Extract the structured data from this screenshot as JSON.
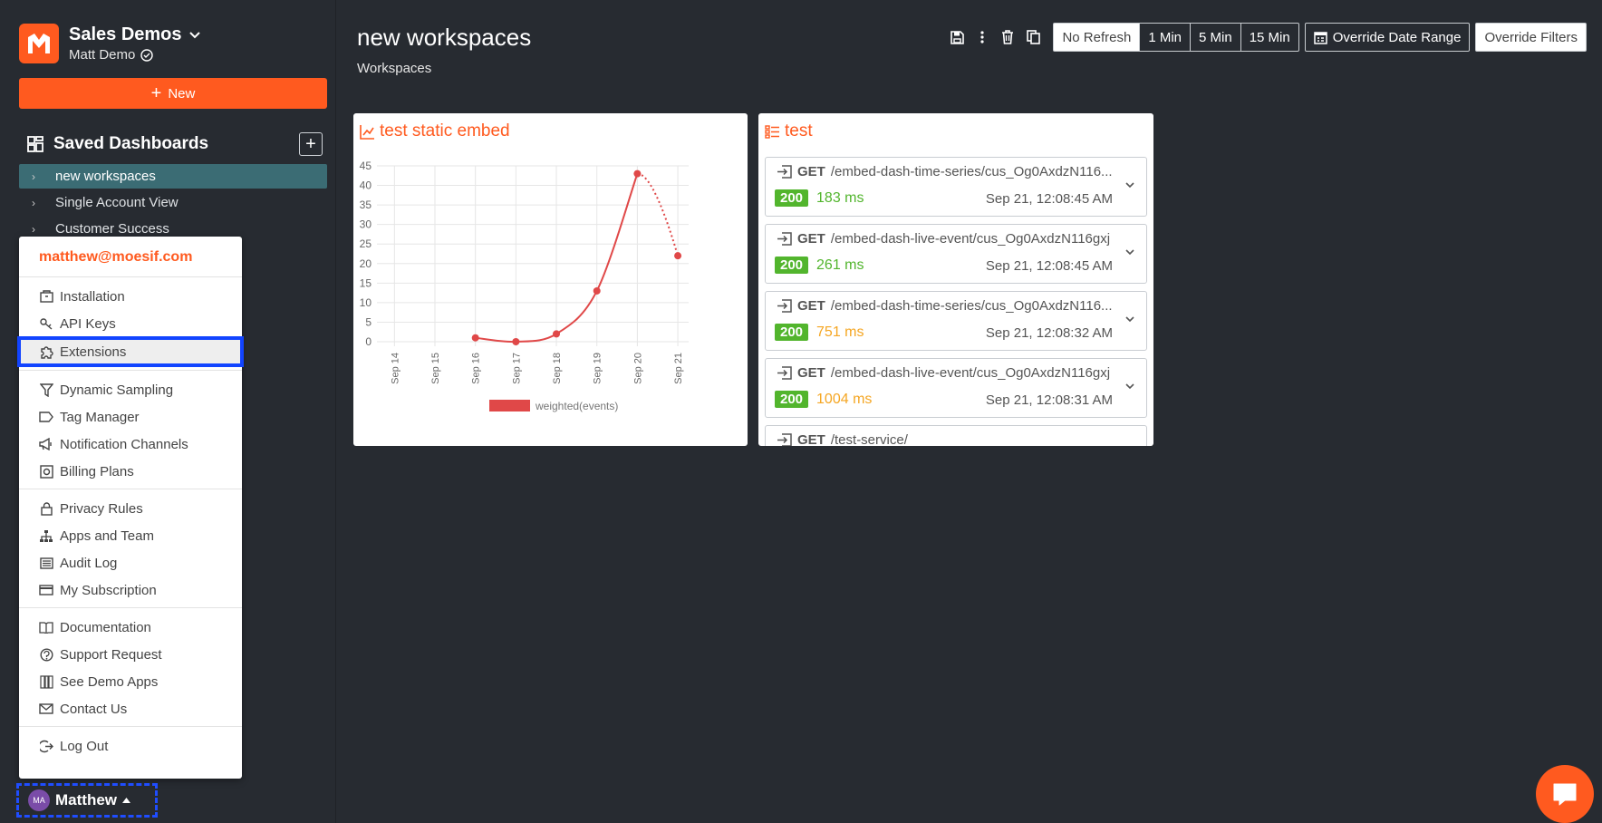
{
  "sidebar": {
    "org_name": "Sales Demos",
    "user_sub": "Matt Demo",
    "new_label": "New",
    "saved_title": "Saved Dashboards",
    "dashboards": [
      {
        "label": "new workspaces",
        "active": true
      },
      {
        "label": "Single Account View",
        "active": false
      },
      {
        "label": "Customer Success",
        "active": false
      }
    ]
  },
  "account_menu": {
    "email": "matthew@moesif.com",
    "groups": [
      [
        {
          "label": "Installation",
          "icon": "installation-icon"
        },
        {
          "label": "API Keys",
          "icon": "key-icon"
        },
        {
          "label": "Extensions",
          "icon": "puzzle-icon",
          "highlight": true
        }
      ],
      [
        {
          "label": "Dynamic Sampling",
          "icon": "filter-icon"
        },
        {
          "label": "Tag Manager",
          "icon": "tag-icon"
        },
        {
          "label": "Notification Channels",
          "icon": "megaphone-icon"
        },
        {
          "label": "Billing Plans",
          "icon": "billing-icon"
        }
      ],
      [
        {
          "label": "Privacy Rules",
          "icon": "lock-icon"
        },
        {
          "label": "Apps and Team",
          "icon": "sitemap-icon"
        },
        {
          "label": "Audit Log",
          "icon": "list-icon"
        },
        {
          "label": "My Subscription",
          "icon": "credit-card-icon"
        }
      ],
      [
        {
          "label": "Documentation",
          "icon": "book-icon"
        },
        {
          "label": "Support Request",
          "icon": "support-icon"
        },
        {
          "label": "See Demo Apps",
          "icon": "apps-icon"
        },
        {
          "label": "Contact Us",
          "icon": "mail-icon"
        }
      ],
      [
        {
          "label": "Log Out",
          "icon": "logout-icon"
        }
      ]
    ]
  },
  "user_chip": {
    "initials": "MA",
    "name": "Matthew"
  },
  "header": {
    "title": "new workspaces",
    "subtitle": "Workspaces",
    "refresh_options": [
      "No Refresh",
      "1 Min",
      "5 Min",
      "15 Min"
    ],
    "refresh_selected": "No Refresh",
    "override_date_label": "Override Date Range",
    "override_filters_label": "Override Filters"
  },
  "colors": {
    "accent": "#ff5a1f",
    "line": "#e04848",
    "success": "#52b52d",
    "slow": "#f5a623",
    "sidebar_active": "#3b6c74"
  },
  "widgets": {
    "chart_title": "test static embed",
    "events_title": "test"
  },
  "chart_data": {
    "type": "line",
    "categories": [
      "Sep 14",
      "Sep 15",
      "Sep 16",
      "Sep 17",
      "Sep 18",
      "Sep 19",
      "Sep 20",
      "Sep 21"
    ],
    "series": [
      {
        "name": "weighted(events)",
        "values": [
          null,
          null,
          1,
          0,
          2,
          13,
          43,
          22
        ]
      }
    ],
    "ylim": [
      0,
      45
    ],
    "yticks": [
      0,
      5,
      10,
      15,
      20,
      25,
      30,
      35,
      40,
      45
    ],
    "grid": true,
    "legend": "bottom",
    "last_segment_dotted": true
  },
  "events": [
    {
      "method": "GET",
      "path": "/embed-dash-time-series/cus_Og0AxdzN116...",
      "status": "200",
      "latency": "183 ms",
      "latency_color": "#52b52d",
      "time": "Sep 21, 12:08:45 AM"
    },
    {
      "method": "GET",
      "path": "/embed-dash-live-event/cus_Og0AxdzN116gxj",
      "status": "200",
      "latency": "261 ms",
      "latency_color": "#52b52d",
      "time": "Sep 21, 12:08:45 AM"
    },
    {
      "method": "GET",
      "path": "/embed-dash-time-series/cus_Og0AxdzN116...",
      "status": "200",
      "latency": "751 ms",
      "latency_color": "#f5a623",
      "time": "Sep 21, 12:08:32 AM"
    },
    {
      "method": "GET",
      "path": "/embed-dash-live-event/cus_Og0AxdzN116gxj",
      "status": "200",
      "latency": "1004 ms",
      "latency_color": "#f5a623",
      "time": "Sep 21, 12:08:31 AM"
    },
    {
      "method": "GET",
      "path": "/test-service/",
      "status": "",
      "latency": "",
      "latency_color": "#52b52d",
      "time": ""
    }
  ]
}
